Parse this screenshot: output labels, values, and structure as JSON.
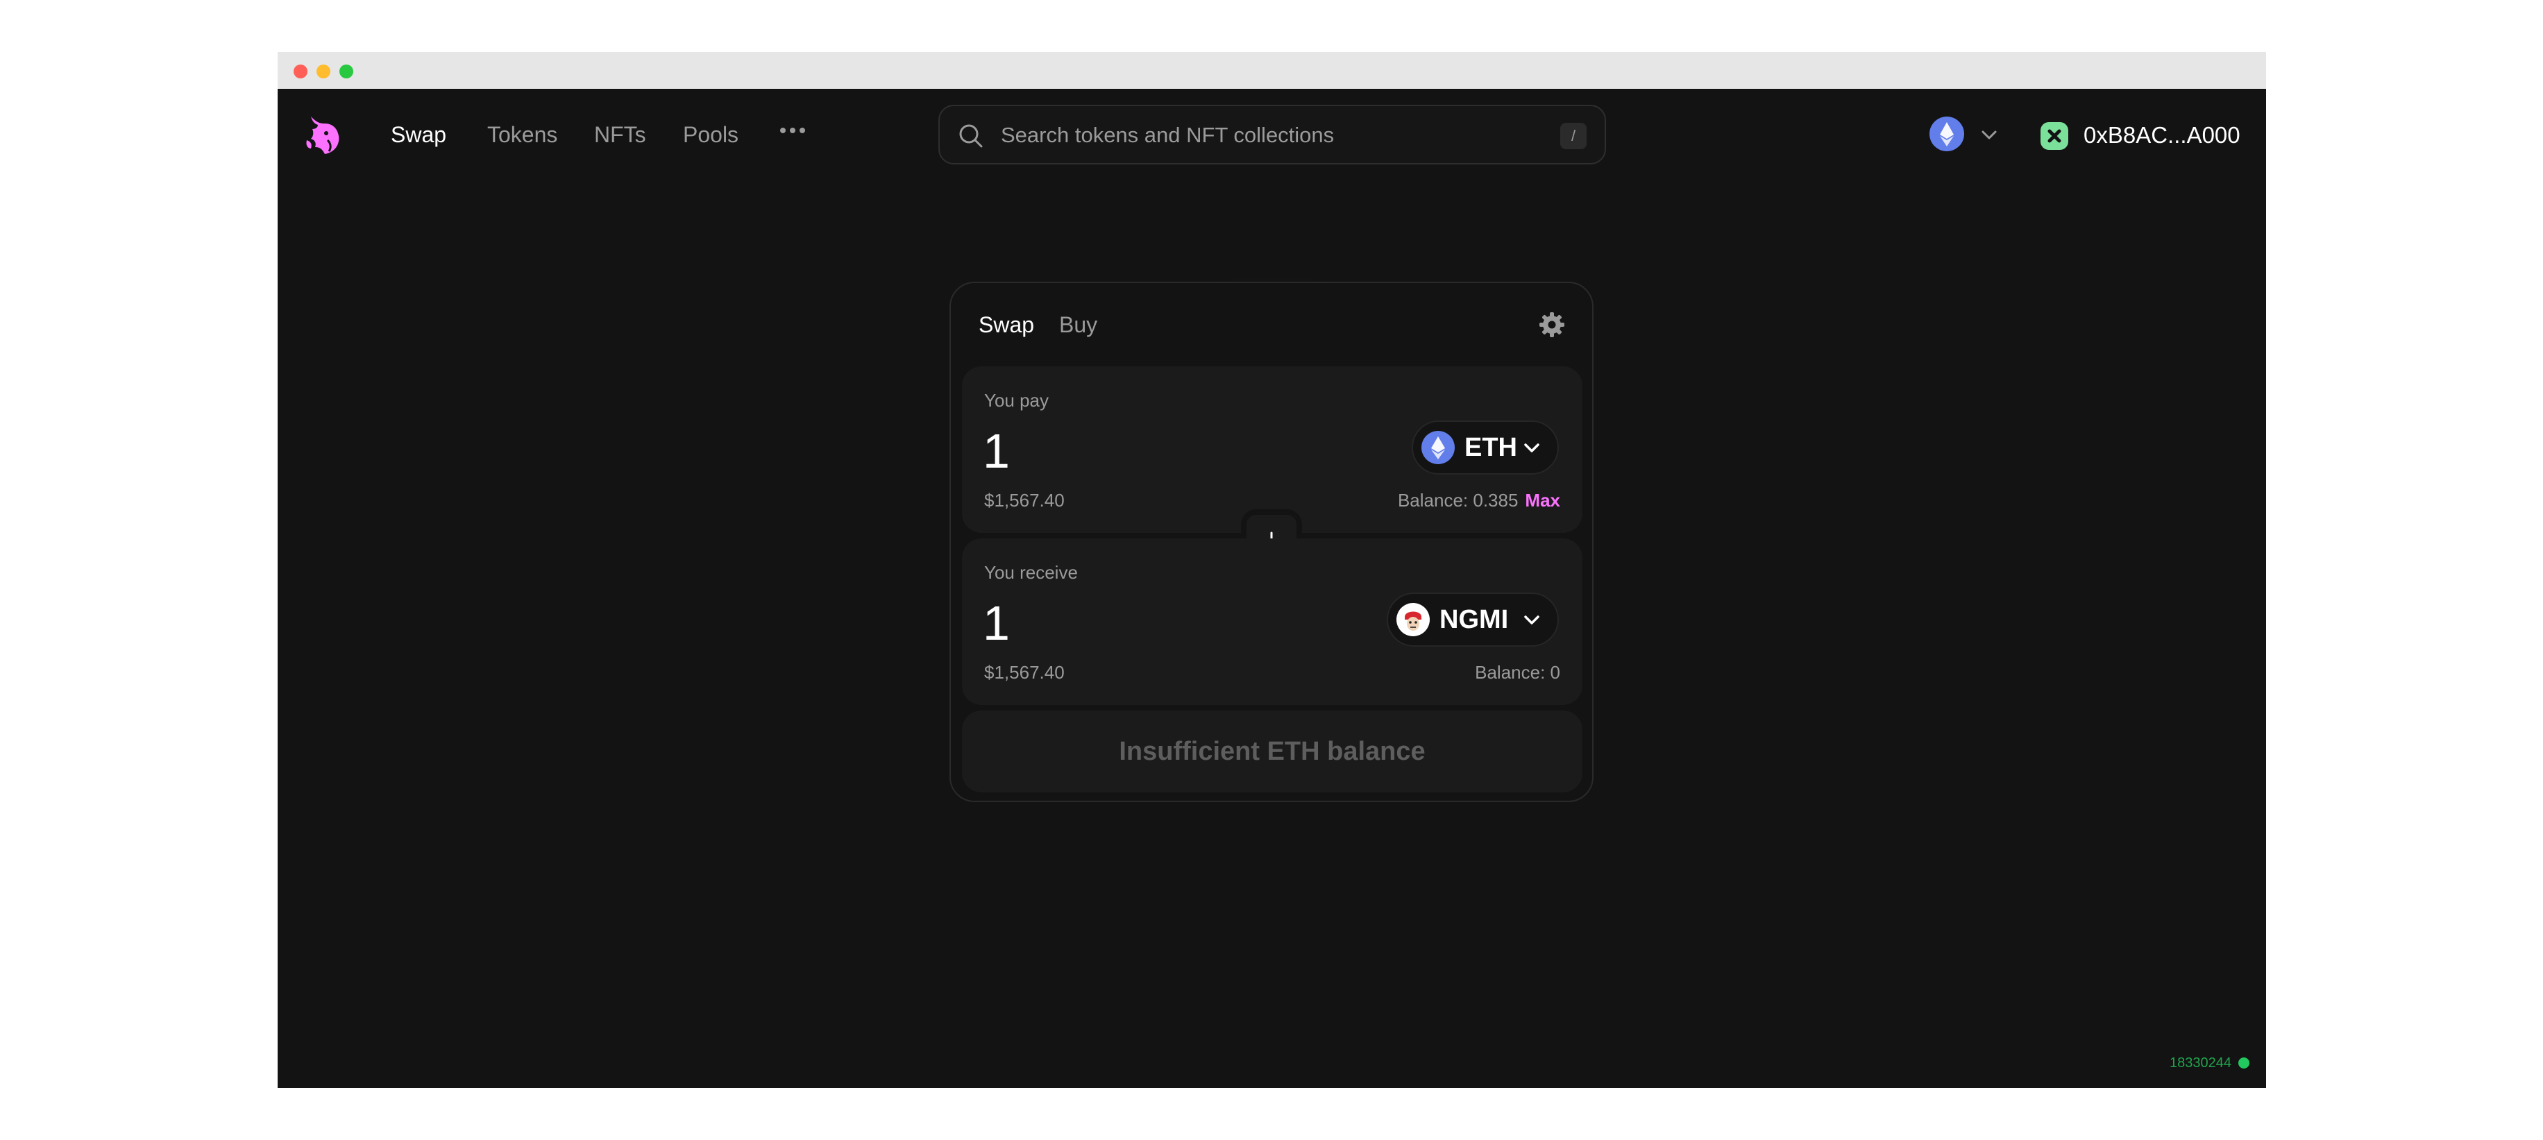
{
  "window": {
    "traffic_lights": [
      "close",
      "minimize",
      "maximize"
    ]
  },
  "nav": {
    "logo_icon": "unicorn-logo-icon",
    "items": [
      {
        "label": "Swap",
        "active": true
      },
      {
        "label": "Tokens",
        "active": false
      },
      {
        "label": "NFTs",
        "active": false
      },
      {
        "label": "Pools",
        "active": false
      }
    ],
    "more_icon": "ellipsis-icon"
  },
  "search": {
    "placeholder": "Search tokens and NFT collections",
    "value": "",
    "shortcut": "/"
  },
  "network": {
    "icon": "ethereum-icon",
    "color": "#627eea"
  },
  "account": {
    "address": "0xB8AC...A000",
    "avatar_color": "#7be09a"
  },
  "swap": {
    "tabs": [
      {
        "label": "Swap",
        "active": true
      },
      {
        "label": "Buy",
        "active": false
      }
    ],
    "pay": {
      "label": "You pay",
      "amount": "1",
      "usd": "$1,567.40",
      "token": "ETH",
      "balance": "Balance: 0.385",
      "max": "Max"
    },
    "receive": {
      "label": "You receive",
      "amount": "1",
      "usd": "$1,567.40",
      "token": "NGMI",
      "balance": "Balance: 0"
    },
    "cta": "Insufficient ETH balance"
  },
  "status": {
    "block_number": "18330244",
    "color": "#21c95e"
  },
  "colors": {
    "accent": "#fc72ff",
    "background": "#131313",
    "surface": "#1b1b1b"
  }
}
